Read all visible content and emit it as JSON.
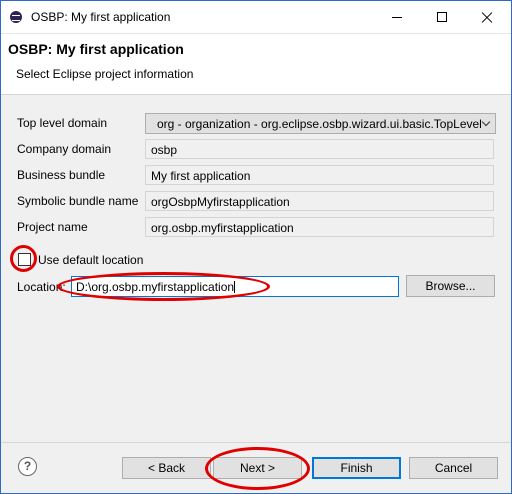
{
  "window": {
    "title": "OSBP: My first application",
    "icon": "eclipse-icon"
  },
  "header": {
    "title": "OSBP: My first application",
    "subtitle": "Select Eclipse project information"
  },
  "form": {
    "top_level_domain": {
      "label": "Top level domain",
      "value": "org - organization - org.eclipse.osbp.wizard.ui.basic.TopLevelDomain"
    },
    "company_domain": {
      "label": "Company domain",
      "value": "osbp"
    },
    "business_bundle": {
      "label": "Business bundle",
      "value": "My first application"
    },
    "symbolic_bundle_name": {
      "label": "Symbolic bundle name",
      "value": "orgOsbpMyfirstapplication"
    },
    "project_name": {
      "label": "Project name",
      "value": "org.osbp.myfirstapplication"
    },
    "use_default_location": {
      "label": "Use default location",
      "checked": false
    },
    "location": {
      "label": "Location:",
      "value": "D:\\org.osbp.myfirstapplication"
    },
    "browse_label": "Browse..."
  },
  "footer": {
    "help_glyph": "?",
    "back_label": "< Back",
    "next_label": "Next >",
    "finish_label": "Finish",
    "cancel_label": "Cancel"
  },
  "highlight": {
    "color": "#e00000"
  }
}
